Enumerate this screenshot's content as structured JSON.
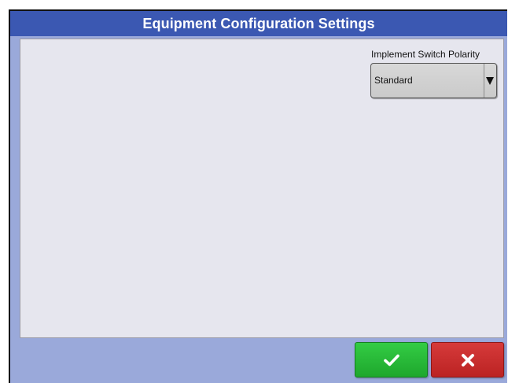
{
  "window": {
    "title": "Equipment Configuration Settings"
  },
  "implement_switch_polarity": {
    "label": "Implement Switch Polarity",
    "selected_value": "Standard",
    "arrow_icon": "dropdown-arrow-icon"
  },
  "footer": {
    "ok_icon": "checkmark-icon",
    "cancel_icon": "close-icon"
  },
  "colors": {
    "title_bar": "#3b58b2",
    "frame_background": "#9aa9da",
    "content_background": "#e6e6ee",
    "ok_button": "#2ab83a",
    "cancel_button": "#c92d2d"
  }
}
